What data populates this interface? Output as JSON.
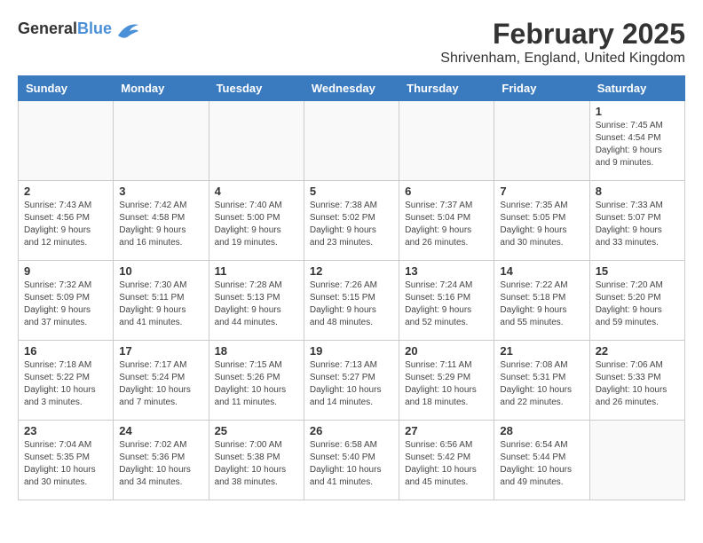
{
  "header": {
    "logo_general": "General",
    "logo_blue": "Blue",
    "month": "February 2025",
    "location": "Shrivenham, England, United Kingdom"
  },
  "weekdays": [
    "Sunday",
    "Monday",
    "Tuesday",
    "Wednesday",
    "Thursday",
    "Friday",
    "Saturday"
  ],
  "weeks": [
    [
      {
        "day": "",
        "info": ""
      },
      {
        "day": "",
        "info": ""
      },
      {
        "day": "",
        "info": ""
      },
      {
        "day": "",
        "info": ""
      },
      {
        "day": "",
        "info": ""
      },
      {
        "day": "",
        "info": ""
      },
      {
        "day": "1",
        "info": "Sunrise: 7:45 AM\nSunset: 4:54 PM\nDaylight: 9 hours and 9 minutes."
      }
    ],
    [
      {
        "day": "2",
        "info": "Sunrise: 7:43 AM\nSunset: 4:56 PM\nDaylight: 9 hours and 12 minutes."
      },
      {
        "day": "3",
        "info": "Sunrise: 7:42 AM\nSunset: 4:58 PM\nDaylight: 9 hours and 16 minutes."
      },
      {
        "day": "4",
        "info": "Sunrise: 7:40 AM\nSunset: 5:00 PM\nDaylight: 9 hours and 19 minutes."
      },
      {
        "day": "5",
        "info": "Sunrise: 7:38 AM\nSunset: 5:02 PM\nDaylight: 9 hours and 23 minutes."
      },
      {
        "day": "6",
        "info": "Sunrise: 7:37 AM\nSunset: 5:04 PM\nDaylight: 9 hours and 26 minutes."
      },
      {
        "day": "7",
        "info": "Sunrise: 7:35 AM\nSunset: 5:05 PM\nDaylight: 9 hours and 30 minutes."
      },
      {
        "day": "8",
        "info": "Sunrise: 7:33 AM\nSunset: 5:07 PM\nDaylight: 9 hours and 33 minutes."
      }
    ],
    [
      {
        "day": "9",
        "info": "Sunrise: 7:32 AM\nSunset: 5:09 PM\nDaylight: 9 hours and 37 minutes."
      },
      {
        "day": "10",
        "info": "Sunrise: 7:30 AM\nSunset: 5:11 PM\nDaylight: 9 hours and 41 minutes."
      },
      {
        "day": "11",
        "info": "Sunrise: 7:28 AM\nSunset: 5:13 PM\nDaylight: 9 hours and 44 minutes."
      },
      {
        "day": "12",
        "info": "Sunrise: 7:26 AM\nSunset: 5:15 PM\nDaylight: 9 hours and 48 minutes."
      },
      {
        "day": "13",
        "info": "Sunrise: 7:24 AM\nSunset: 5:16 PM\nDaylight: 9 hours and 52 minutes."
      },
      {
        "day": "14",
        "info": "Sunrise: 7:22 AM\nSunset: 5:18 PM\nDaylight: 9 hours and 55 minutes."
      },
      {
        "day": "15",
        "info": "Sunrise: 7:20 AM\nSunset: 5:20 PM\nDaylight: 9 hours and 59 minutes."
      }
    ],
    [
      {
        "day": "16",
        "info": "Sunrise: 7:18 AM\nSunset: 5:22 PM\nDaylight: 10 hours and 3 minutes."
      },
      {
        "day": "17",
        "info": "Sunrise: 7:17 AM\nSunset: 5:24 PM\nDaylight: 10 hours and 7 minutes."
      },
      {
        "day": "18",
        "info": "Sunrise: 7:15 AM\nSunset: 5:26 PM\nDaylight: 10 hours and 11 minutes."
      },
      {
        "day": "19",
        "info": "Sunrise: 7:13 AM\nSunset: 5:27 PM\nDaylight: 10 hours and 14 minutes."
      },
      {
        "day": "20",
        "info": "Sunrise: 7:11 AM\nSunset: 5:29 PM\nDaylight: 10 hours and 18 minutes."
      },
      {
        "day": "21",
        "info": "Sunrise: 7:08 AM\nSunset: 5:31 PM\nDaylight: 10 hours and 22 minutes."
      },
      {
        "day": "22",
        "info": "Sunrise: 7:06 AM\nSunset: 5:33 PM\nDaylight: 10 hours and 26 minutes."
      }
    ],
    [
      {
        "day": "23",
        "info": "Sunrise: 7:04 AM\nSunset: 5:35 PM\nDaylight: 10 hours and 30 minutes."
      },
      {
        "day": "24",
        "info": "Sunrise: 7:02 AM\nSunset: 5:36 PM\nDaylight: 10 hours and 34 minutes."
      },
      {
        "day": "25",
        "info": "Sunrise: 7:00 AM\nSunset: 5:38 PM\nDaylight: 10 hours and 38 minutes."
      },
      {
        "day": "26",
        "info": "Sunrise: 6:58 AM\nSunset: 5:40 PM\nDaylight: 10 hours and 41 minutes."
      },
      {
        "day": "27",
        "info": "Sunrise: 6:56 AM\nSunset: 5:42 PM\nDaylight: 10 hours and 45 minutes."
      },
      {
        "day": "28",
        "info": "Sunrise: 6:54 AM\nSunset: 5:44 PM\nDaylight: 10 hours and 49 minutes."
      },
      {
        "day": "",
        "info": ""
      }
    ]
  ]
}
